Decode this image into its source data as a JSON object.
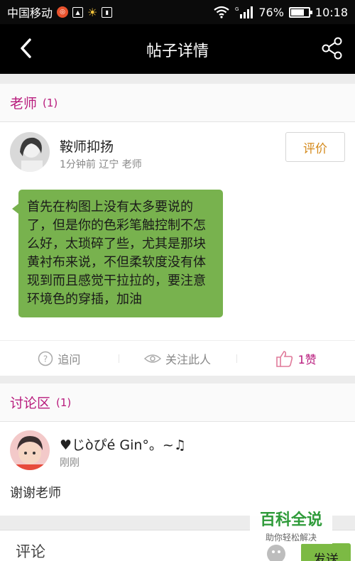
{
  "statusbar": {
    "carrier": "中国移动",
    "battery": "76%",
    "battery_level": 0.76,
    "time": "10:18",
    "network": "G"
  },
  "navbar": {
    "title": "帖子详情"
  },
  "teacher_section": {
    "title": "老师",
    "count": "(1)"
  },
  "teacher_post": {
    "author": "鞍师抑扬",
    "meta": "1分钟前  辽宁  老师",
    "rate_label": "评价",
    "message": "首先在构图上没有太多要说的了，但是你的色彩笔触控制不怎么好，太琐碎了些，尤其是那块黄衬布来说，不但柔软度没有体现到而且感觉干拉拉的，要注意环境色的穿插，加油",
    "actions": {
      "ask": "追问",
      "follow": "关注此人",
      "like": "1赞"
    }
  },
  "discussion_section": {
    "title": "讨论区",
    "count": "(1)"
  },
  "discussion_item": {
    "author": "♥じòぴé Gin°。~♫",
    "time": "刚刚",
    "text": "谢谢老师"
  },
  "comment_bar": {
    "placeholder": "评论",
    "send_label": "发送"
  },
  "watermark": {
    "title": "百科全说",
    "subtitle": "助你轻松解决"
  },
  "colors": {
    "accent": "#b81a7c",
    "bubble": "#78b24e",
    "send": "#7cba44",
    "rate": "#d48a1c"
  }
}
